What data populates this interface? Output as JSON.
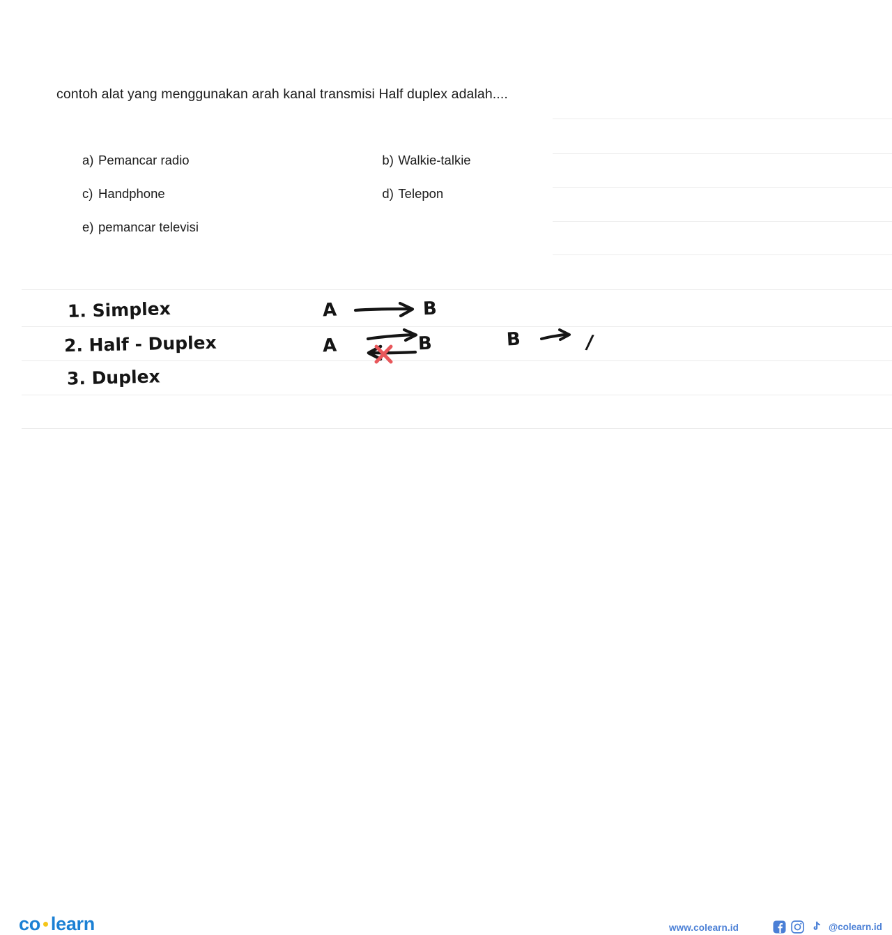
{
  "question": {
    "text": "contoh alat yang menggunakan arah kanal transmisi Half duplex adalah...."
  },
  "options": [
    {
      "letter": "a)",
      "label": "Pemancar radio"
    },
    {
      "letter": "b)",
      "label": "Walkie-talkie"
    },
    {
      "letter": "c)",
      "label": "Handphone"
    },
    {
      "letter": "d)",
      "label": "Telepon"
    },
    {
      "letter": "e)",
      "label": "pemancar televisi"
    }
  ],
  "handwriting": {
    "line1": "1. Simplex",
    "line2": "2. Half - Duplex",
    "line3": "3. Duplex",
    "diagram": {
      "row1_left": "A",
      "row1_right": "B",
      "row2_left": "A",
      "row2_right": "B",
      "note_left": "B",
      "note_right": "/"
    }
  },
  "colors": {
    "brand_blue": "#1b80d4",
    "footer_blue": "#4a7fd6",
    "logo_dot_yellow": "#f5c518",
    "red_mark": "#e8575b",
    "rule_line": "#ebebeb",
    "ink": "#151515"
  },
  "rules": {
    "right_lines_y": [
      170,
      220,
      268,
      317,
      365
    ],
    "full_lines_y": [
      415,
      468,
      517,
      566,
      614
    ]
  },
  "footer": {
    "logo_part1": "co",
    "logo_part2": "learn",
    "url": "www.colearn.id",
    "handle": "@colearn.id",
    "icons": [
      "facebook-icon",
      "instagram-icon",
      "tiktok-icon"
    ]
  }
}
